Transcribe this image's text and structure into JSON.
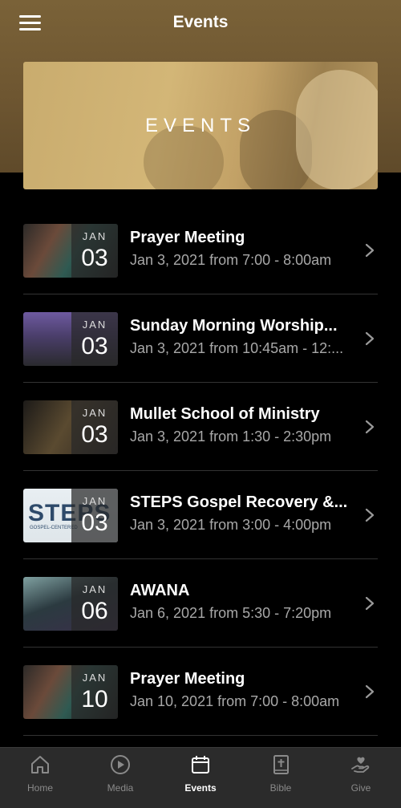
{
  "header": {
    "title": "Events"
  },
  "banner": {
    "text": "EVENTS"
  },
  "events": [
    {
      "name": "Prayer Meeting",
      "when": "Jan 3, 2021 from 7:00 - 8:00am",
      "month": "JAN",
      "day": "03"
    },
    {
      "name": "Sunday Morning Worship...",
      "when": "Jan 3, 2021 from 10:45am - 12:...",
      "month": "JAN",
      "day": "03"
    },
    {
      "name": "Mullet School of Ministry",
      "when": "Jan 3, 2021 from 1:30 - 2:30pm",
      "month": "JAN",
      "day": "03"
    },
    {
      "name": "STEPS Gospel Recovery &...",
      "when": "Jan 3, 2021 from 3:00 - 4:00pm",
      "month": "JAN",
      "day": "03",
      "thumb_text": "STEPS",
      "thumb_subtext": "GOSPEL-CENTERED"
    },
    {
      "name": "AWANA",
      "when": "Jan 6, 2021 from 5:30 - 7:20pm",
      "month": "JAN",
      "day": "06"
    },
    {
      "name": "Prayer Meeting",
      "when": "Jan 10, 2021 from 7:00 - 8:00am",
      "month": "JAN",
      "day": "10"
    }
  ],
  "tabbar": {
    "items": [
      {
        "label": "Home",
        "icon": "home-icon"
      },
      {
        "label": "Media",
        "icon": "play-icon"
      },
      {
        "label": "Events",
        "icon": "calendar-icon",
        "active": true
      },
      {
        "label": "Bible",
        "icon": "bible-icon"
      },
      {
        "label": "Give",
        "icon": "give-icon"
      }
    ]
  },
  "colors": {
    "header": "#6e5631",
    "background": "#000000",
    "tabbar": "#2b2b2b",
    "active_tab": "#ffffff",
    "inactive_tab": "#8a8a8a"
  }
}
